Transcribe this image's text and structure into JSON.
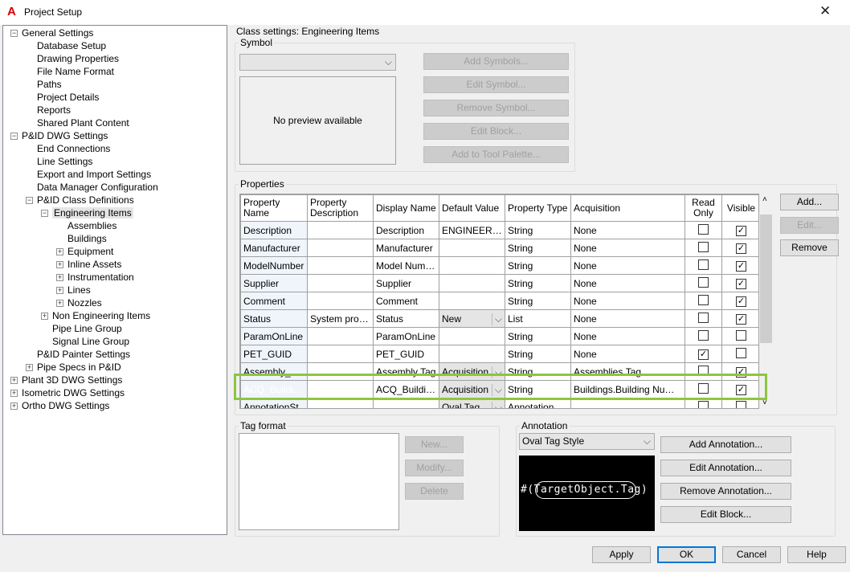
{
  "window": {
    "title": "Project Setup",
    "close": "✕"
  },
  "tree": [
    {
      "label": "General Settings",
      "level": 0,
      "exp": "-"
    },
    {
      "label": "Database Setup",
      "level": 1
    },
    {
      "label": "Drawing Properties",
      "level": 1
    },
    {
      "label": "File Name Format",
      "level": 1
    },
    {
      "label": "Paths",
      "level": 1
    },
    {
      "label": "Project Details",
      "level": 1
    },
    {
      "label": "Reports",
      "level": 1
    },
    {
      "label": "Shared Plant Content",
      "level": 1
    },
    {
      "label": "P&ID DWG Settings",
      "level": 0,
      "exp": "-"
    },
    {
      "label": "End Connections",
      "level": 1
    },
    {
      "label": "Line Settings",
      "level": 1
    },
    {
      "label": "Export and Import Settings",
      "level": 1
    },
    {
      "label": "Data Manager Configuration",
      "level": 1
    },
    {
      "label": "P&ID Class Definitions",
      "level": 1,
      "exp": "-"
    },
    {
      "label": "Engineering Items",
      "level": 2,
      "exp": "-",
      "selected": true
    },
    {
      "label": "Assemblies",
      "level": 3
    },
    {
      "label": "Buildings",
      "level": 3
    },
    {
      "label": "Equipment",
      "level": 3,
      "exp": "+"
    },
    {
      "label": "Inline Assets",
      "level": 3,
      "exp": "+"
    },
    {
      "label": "Instrumentation",
      "level": 3,
      "exp": "+"
    },
    {
      "label": "Lines",
      "level": 3,
      "exp": "+"
    },
    {
      "label": "Nozzles",
      "level": 3,
      "exp": "+"
    },
    {
      "label": "Non Engineering Items",
      "level": 2,
      "exp": "+"
    },
    {
      "label": "Pipe Line Group",
      "level": 2
    },
    {
      "label": "Signal Line Group",
      "level": 2
    },
    {
      "label": "P&ID Painter Settings",
      "level": 1
    },
    {
      "label": "Pipe Specs in P&ID",
      "level": 1,
      "exp": "+"
    },
    {
      "label": "Plant 3D DWG Settings",
      "level": 0,
      "exp": "+"
    },
    {
      "label": "Isometric DWG Settings",
      "level": 0,
      "exp": "+"
    },
    {
      "label": "Ortho DWG Settings",
      "level": 0,
      "exp": "+"
    }
  ],
  "class_settings": {
    "label": "Class settings: Engineering Items"
  },
  "symbol": {
    "legend": "Symbol",
    "combo_value": "",
    "preview": "No preview available",
    "buttons": [
      "Add Symbols...",
      "Edit Symbol...",
      "Remove Symbol...",
      "Edit Block...",
      "Add to Tool Palette..."
    ]
  },
  "properties": {
    "legend": "Properties",
    "columns": [
      "Property Name",
      "Property Description",
      "Display Name",
      "Default Value",
      "Property Type",
      "Acquisition",
      "Read Only",
      "Visible"
    ],
    "rows": [
      {
        "name": "Description",
        "desc": "",
        "display": "Description",
        "default": "ENGINEERI...",
        "type": "String",
        "acq": "None",
        "ro": false,
        "vis": true
      },
      {
        "name": "Manufacturer",
        "desc": "",
        "display": "Manufacturer",
        "default": "",
        "type": "String",
        "acq": "None",
        "ro": false,
        "vis": true
      },
      {
        "name": "ModelNumber",
        "desc": "",
        "display": "Model Number",
        "default": "",
        "type": "String",
        "acq": "None",
        "ro": false,
        "vis": true
      },
      {
        "name": "Supplier",
        "desc": "",
        "display": "Supplier",
        "default": "",
        "type": "String",
        "acq": "None",
        "ro": false,
        "vis": true
      },
      {
        "name": "Comment",
        "desc": "",
        "display": "Comment",
        "default": "",
        "type": "String",
        "acq": "None",
        "ro": false,
        "vis": true
      },
      {
        "name": "Status",
        "desc": "System prope...",
        "display": "Status",
        "default": "New",
        "dd": true,
        "type": "List",
        "acq": "None",
        "ro": false,
        "vis": true
      },
      {
        "name": "ParamOnLine",
        "desc": "",
        "display": "ParamOnLine",
        "default": "",
        "type": "String",
        "acq": "None",
        "ro": false,
        "vis": false
      },
      {
        "name": "PET_GUID",
        "desc": "",
        "display": "PET_GUID",
        "default": "",
        "type": "String",
        "acq": "None",
        "ro": true,
        "vis": false
      },
      {
        "name": "Assembly_Tag",
        "desc": "",
        "display": "Assembly Tag",
        "default": "Acquisition",
        "dd": true,
        "type": "String",
        "acq": "Assemblies.Tag",
        "ro": false,
        "vis": true
      },
      {
        "name": "ACQ_Building...",
        "desc": "",
        "display": "ACQ_Building...",
        "default": "Acquisition",
        "dd": true,
        "type": "String",
        "acq": "Buildings.Building Number",
        "ro": false,
        "vis": true,
        "selected": true
      },
      {
        "name": "AnnotationSt",
        "desc": "",
        "display": "",
        "default": "Oval Tag",
        "dd": true,
        "type": "Annotation",
        "acq": "",
        "ro": false,
        "vis": false
      }
    ],
    "buttons": {
      "add": "Add...",
      "edit": "Edit...",
      "remove": "Remove"
    },
    "highlight_color": "#8cc63f"
  },
  "tag_format": {
    "legend": "Tag format",
    "buttons": [
      "New...",
      "Modify...",
      "Delete"
    ]
  },
  "annotation": {
    "legend": "Annotation",
    "style": "Oval Tag Style",
    "preview": "#(TargetObject.Tag)",
    "buttons": [
      "Add Annotation...",
      "Edit Annotation...",
      "Remove Annotation...",
      "Edit Block..."
    ]
  },
  "footer": {
    "apply": "Apply",
    "ok": "OK",
    "cancel": "Cancel",
    "help": "Help"
  }
}
